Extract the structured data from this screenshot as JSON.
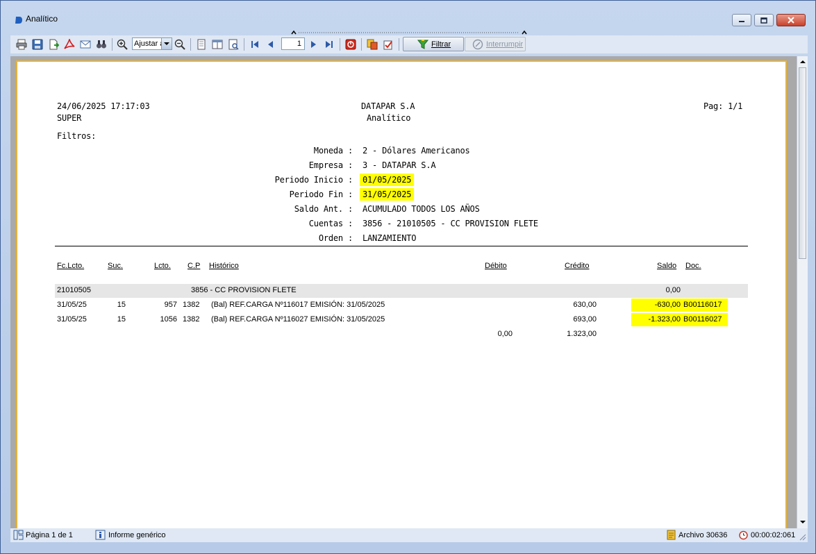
{
  "window": {
    "title": "Analítico",
    "controls": [
      "minimize-icon",
      "maximize-icon",
      "close-icon"
    ]
  },
  "toolbar": {
    "zoom_value": "Ajustar a",
    "page_value": "1",
    "filter_label": "Filtrar",
    "interrupt_label": "Interrumpir"
  },
  "report": {
    "datetime": "24/06/2025 17:17:03",
    "user": "SUPER",
    "company": "DATAPAR S.A",
    "report_name": "Analítico",
    "page": "Pag: 1/1",
    "filters_title": "Filtros:",
    "filters": [
      {
        "label": "Moneda :",
        "value": "2 - Dólares Americanos",
        "highlight": false
      },
      {
        "label": "Empresa :",
        "value": "3 - DATAPAR S.A",
        "highlight": false
      },
      {
        "label": "Periodo Inicio :",
        "value": "01/05/2025",
        "highlight": true
      },
      {
        "label": "Periodo Fin :",
        "value": "31/05/2025",
        "highlight": true
      },
      {
        "label": "Saldo Ant. :",
        "value": "ACUMULADO TODOS LOS AÑOS",
        "highlight": false
      },
      {
        "label": "Cuentas :",
        "value": "3856 - 21010505 - CC PROVISION FLETE",
        "highlight": false
      },
      {
        "label": "Orden :",
        "value": "LANZAMIENTO",
        "highlight": false
      }
    ],
    "columns": {
      "fecha": "Fc.Lcto.",
      "suc": "Suc.",
      "lcto": "Lcto.",
      "cp": "C.P",
      "historico": "Histórico",
      "debito": "Débito",
      "credito": "Crédito",
      "saldo": "Saldo",
      "doc": "Doc."
    },
    "group": {
      "account": "21010505",
      "description": "3856 - CC PROVISION FLETE",
      "saldo": "0,00"
    },
    "rows": [
      {
        "fecha": "31/05/25",
        "suc": "15",
        "lcto": "957",
        "cp": "1382",
        "historico": "(Bal) REF.CARGA Nº116017 EMISIÓN: 31/05/2025",
        "debito": "",
        "credito": "630,00",
        "saldo": "-630,00",
        "doc": "B00116017"
      },
      {
        "fecha": "31/05/25",
        "suc": "15",
        "lcto": "1056",
        "cp": "1382",
        "historico": "(Bal) REF.CARGA Nº116027 EMISIÓN: 31/05/2025",
        "debito": "",
        "credito": "693,00",
        "saldo": "-1.323,00",
        "doc": "B00116027"
      }
    ],
    "totals": {
      "debito": "0,00",
      "credito": "1.323,00"
    }
  },
  "status": {
    "page_info": "Página 1 de 1",
    "report_type": "Informe genérico",
    "file": "Archivo 30636",
    "elapsed": "00:00:02:061"
  },
  "colors": {
    "highlight": "#ffff00",
    "paper_border": "#e5b43b",
    "viewer_bg": "#a9a9a9"
  }
}
